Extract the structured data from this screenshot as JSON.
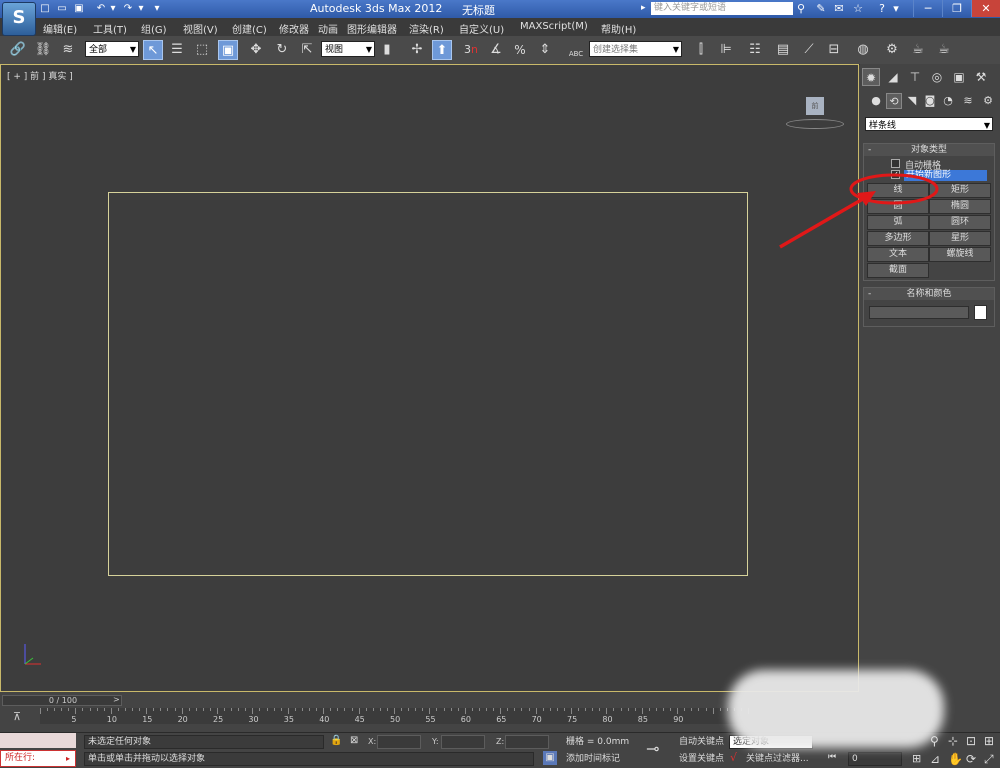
{
  "titlebar": {
    "app_logo": "S",
    "app_title": "Autodesk 3ds Max  2012",
    "doc_title": "无标题",
    "search_placeholder": "键入关键字或短语"
  },
  "menubar": {
    "items": [
      "编辑(E)",
      "工具(T)",
      "组(G)",
      "视图(V)",
      "创建(C)",
      "修改器",
      "动画",
      "图形编辑器",
      "渲染(R)",
      "自定义(U)",
      "MAXScript(M)",
      "帮助(H)"
    ]
  },
  "toolbar": {
    "selection_filter": "全部",
    "ref_coord": "视图",
    "named_selection_placeholder": "创建选择集",
    "snap_3_label": "3",
    "snap_3_sup": "n",
    "percent_label": "%",
    "abc_label": "ABC"
  },
  "viewport": {
    "label": "[ + ] 前 ] 真实 ]",
    "viewcube_label": "前"
  },
  "command_panel": {
    "category": "样条线",
    "object_type": {
      "title": "对象类型",
      "auto_grid": "自动栅格",
      "start_new_shape": "开始新图形",
      "buttons": [
        "线",
        "矩形",
        "圆",
        "椭圆",
        "弧",
        "圆环",
        "多边形",
        "星形",
        "文本",
        "螺旋线",
        "截面"
      ]
    },
    "name_color": {
      "title": "名称和颜色",
      "name_value": ""
    }
  },
  "timeline": {
    "frame_counter": "0 / 100",
    "ticks": [
      "5",
      "10",
      "15",
      "20",
      "25",
      "30",
      "35",
      "40",
      "45",
      "50",
      "55",
      "60",
      "65",
      "70",
      "75",
      "80",
      "85",
      "90"
    ]
  },
  "statusbar": {
    "running_label": "所在行:",
    "status1": "未选定任何对象",
    "status2": "单击或单击并拖动以选择对象",
    "x_label": "X:",
    "y_label": "Y:",
    "z_label": "Z:",
    "grid": "栅格 = 0.0mm",
    "add_time_tag": "添加时间标记",
    "auto_key": "自动关键点",
    "set_key": "设置关键点",
    "selected": "选定对象",
    "key_filters": "关键点过滤器...",
    "frame_value": "0"
  },
  "colors": {
    "viewport_bg": "#3d3d3d",
    "viewport_border": "#c9b96a",
    "shape_rect": "#d6d29a",
    "annotation_red": "#e01818",
    "title_blue": "#2f5aa8",
    "highlight_blue": "#3c78d8"
  }
}
